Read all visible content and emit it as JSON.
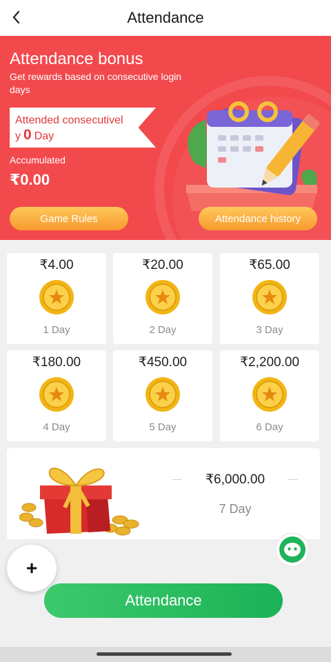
{
  "header": {
    "title": "Attendance",
    "back_icon": "chevron-left-icon"
  },
  "banner": {
    "title": "Attendance bonus",
    "subtitle": "Get rewards based on consecutive login days",
    "streak_prefix": "Attended consecutivel y",
    "streak_count": "0",
    "streak_suffix": "Day",
    "accumulated_label": "Accumulated",
    "accumulated_value": "₹0.00",
    "rules_button": "Game Rules",
    "history_button": "Attendance history",
    "background_color": "#f2494d",
    "illustration": "calendar-pencil-icon"
  },
  "rewards": [
    {
      "amount": "₹4.00",
      "day": "1 Day",
      "icon": "coin-star-icon"
    },
    {
      "amount": "₹20.00",
      "day": "2 Day",
      "icon": "coin-star-icon"
    },
    {
      "amount": "₹65.00",
      "day": "3 Day",
      "icon": "coin-star-icon"
    },
    {
      "amount": "₹180.00",
      "day": "4 Day",
      "icon": "coin-star-icon"
    },
    {
      "amount": "₹450.00",
      "day": "5 Day",
      "icon": "coin-star-icon"
    },
    {
      "amount": "₹2,200.00",
      "day": "6 Day",
      "icon": "coin-star-icon"
    }
  ],
  "final_reward": {
    "amount": "₹6,000.00",
    "day": "7 Day",
    "icon": "gift-box-icon"
  },
  "floating": {
    "plus": "+",
    "chat_icon": "chat-bubble-icon"
  },
  "action": {
    "attendance_button": "Attendance",
    "color": "#22b85b"
  }
}
